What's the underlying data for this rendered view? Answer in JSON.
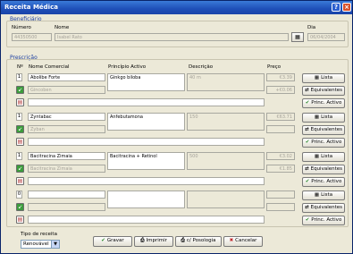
{
  "window": {
    "title": "Receita Médica",
    "help_label": "?",
    "close_label": "×"
  },
  "beneficiario": {
    "group_label": "Beneficiário",
    "numero_label": "Número",
    "nome_label": "Nome",
    "dia_label": "Dia",
    "numero": "44350500",
    "nome": "Isabel Rato",
    "dia": "06/04/2004"
  },
  "prescricao": {
    "group_label": "Prescrição",
    "headers": {
      "n": "Nº",
      "nome_comercial": "Nome Comercial",
      "principio_activo": "Princípio Activo",
      "descricao": "Descrição",
      "preco": "Preço"
    },
    "buttons": {
      "lista": "Lista",
      "equivalentes": "Equivalentes",
      "princ_activo": "Princ. Activo"
    },
    "rows": [
      {
        "qty": "1",
        "nome": "Abolibe Forte",
        "generico": "Gincoben",
        "principio": "Ginkgo biloba",
        "descricao": "40 m",
        "preco": "€3.39",
        "preco_gen": "+€0.06"
      },
      {
        "qty": "1",
        "nome": "Zyntabac",
        "generico": "Zyban",
        "principio": "Anfebutamona",
        "descricao": "150",
        "preco": "€63.71",
        "preco_gen": ""
      },
      {
        "qty": "1",
        "nome": "Bacitracina Zimaia",
        "generico": "Bacitracina Zimaia",
        "principio": "Bacitracina + Retinol",
        "descricao": "500",
        "preco": "€3.02",
        "preco_gen": "€1.85"
      },
      {
        "qty": "0",
        "nome": "",
        "generico": "",
        "principio": "",
        "descricao": "",
        "preco": "",
        "preco_gen": ""
      }
    ]
  },
  "footer": {
    "tipo_label": "Tipo de receita",
    "tipo_value": "Renovável",
    "gravar": "Gravar",
    "imprimir": "Imprimir",
    "posologia": "c/ Posologia",
    "cancelar": "Cancelar"
  },
  "colors": {
    "title_bar": "#1e4fb8",
    "group_label": "#1c3fa0",
    "check_green": "#2e8b2e",
    "cancel_red": "#c0282a"
  }
}
